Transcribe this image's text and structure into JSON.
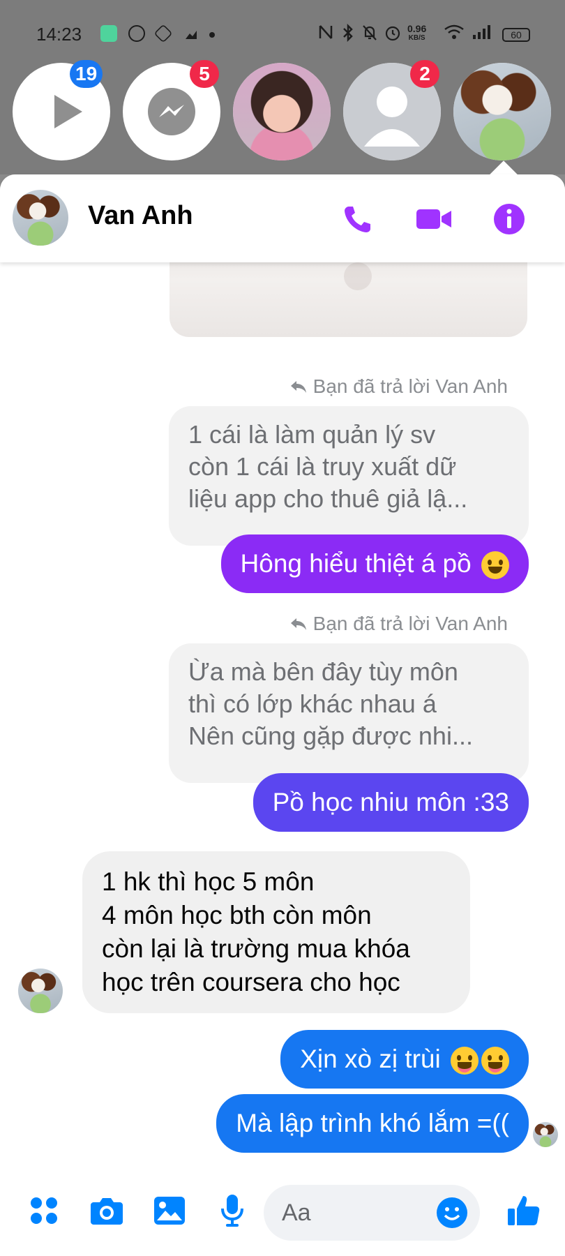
{
  "status_bar": {
    "time": "14:23",
    "net_speed_value": "0.96",
    "net_speed_unit": "KB/S",
    "battery": "60"
  },
  "chat_heads": [
    {
      "name": "video-chat-head",
      "badge": "19",
      "badge_color": "#1877f2"
    },
    {
      "name": "messenger-chat-head",
      "badge": "5",
      "badge_color": "#f02849"
    },
    {
      "name": "girl-chat-head",
      "badge": ""
    },
    {
      "name": "default-user-chat-head",
      "badge": "2",
      "badge_color": "#f02849"
    },
    {
      "name": "van-anh-chat-head",
      "badge": ""
    }
  ],
  "header": {
    "contact_name": "Van Anh",
    "accent_color": "#a033ff"
  },
  "messages": {
    "reply_label_1": "Bạn đã trả lời Van Anh",
    "quoted_1_line1": "1 cái là làm quản lý sv",
    "quoted_1_line2": "còn 1 cái là truy xuất dữ",
    "quoted_1_line3": "liệu app cho thuê giả lậ...",
    "out_1": "Hông hiểu thiệt á pồ",
    "reply_label_2": "Bạn đã trả lời Van Anh",
    "quoted_2_line1": "Ừa mà bên đây tùy môn",
    "quoted_2_line2": "thì có lớp khác nhau á",
    "quoted_2_line3": "Nên cũng gặp được nhi...",
    "out_2": "Pồ học nhiu môn :33",
    "in_1_line1": "1 hk thì học 5 môn",
    "in_1_line2": "4 môn học bth còn môn",
    "in_1_line3": "còn lại là trường mua khóa",
    "in_1_line4": "học trên coursera cho học",
    "out_3": "Xịn xò zị trùi",
    "out_4": "Mà lập trình khó lắm =(("
  },
  "composer": {
    "placeholder": "Aa",
    "accent_color": "#0084ff"
  },
  "colors": {
    "bubble_purple": "#8b2bf5",
    "bubble_indigo": "#5b46f0",
    "bubble_blue": "#1677f2"
  }
}
